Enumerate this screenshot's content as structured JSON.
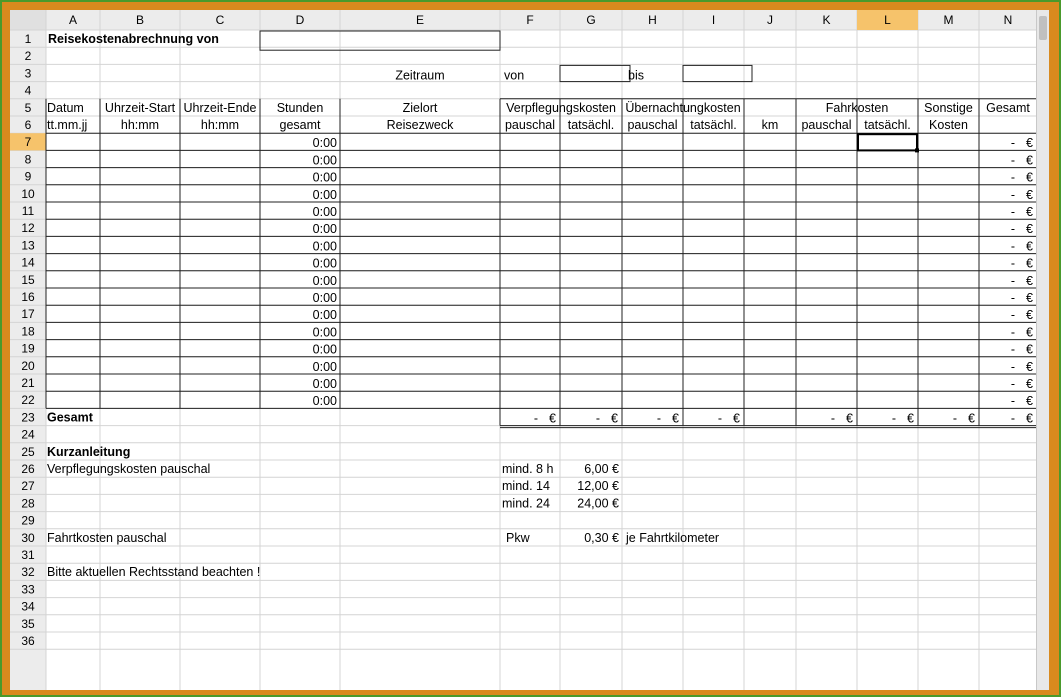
{
  "columns": [
    "A",
    "B",
    "C",
    "D",
    "E",
    "F",
    "G",
    "H",
    "I",
    "J",
    "K",
    "L",
    "M",
    "N"
  ],
  "rows": [
    "1",
    "2",
    "3",
    "4",
    "5",
    "6",
    "7",
    "8",
    "9",
    "10",
    "11",
    "12",
    "13",
    "14",
    "15",
    "16",
    "17",
    "18",
    "19",
    "20",
    "21",
    "22",
    "23",
    "24",
    "25",
    "26",
    "27",
    "28",
    "29",
    "30",
    "31",
    "32",
    "33",
    "34",
    "35",
    "36"
  ],
  "selected_cell": "L7",
  "title": "Reisekostenabrechnung von",
  "period": {
    "label": "Zeitraum",
    "from": "von",
    "to": "bis"
  },
  "headers": {
    "datum": "Datum",
    "datum_fmt": "tt.mm.jj",
    "start": "Uhrzeit-Start",
    "start_fmt": "hh:mm",
    "end": "Uhrzeit-Ende",
    "end_fmt": "hh:mm",
    "hours": "Stunden",
    "hours2": "gesamt",
    "zielort": "Zielort",
    "reisezweck": "Reisezweck",
    "verpflegung": "Verpflegungskosten",
    "uebernachtung": "Übernachtungkosten",
    "pauschal": "pauschal",
    "tatsaechl": "tatsächl.",
    "km": "km",
    "fahrkosten": "Fahrkosten",
    "sonstige": "Sonstige",
    "kosten": "Kosten",
    "gesamt": "Gesamt"
  },
  "hours_value": "0:00",
  "dash": "-",
  "euro": "€",
  "gesamt_label": "Gesamt",
  "kurz": {
    "title": "Kurzanleitung",
    "verpflegung": "Verpflegungskosten pauschal",
    "rates": [
      {
        "label": "mind. 8 h",
        "value": "6,00 €"
      },
      {
        "label": "mind. 14",
        "value": "12,00 €"
      },
      {
        "label": "mind. 24",
        "value": "24,00 €"
      }
    ],
    "fahrt": "Fahrtkosten pauschal",
    "pkw": "Pkw",
    "pkw_value": "0,30 €",
    "pkw_unit": "je Fahrtkilometer",
    "note": "Bitte aktuellen Rechtsstand beachten !"
  }
}
